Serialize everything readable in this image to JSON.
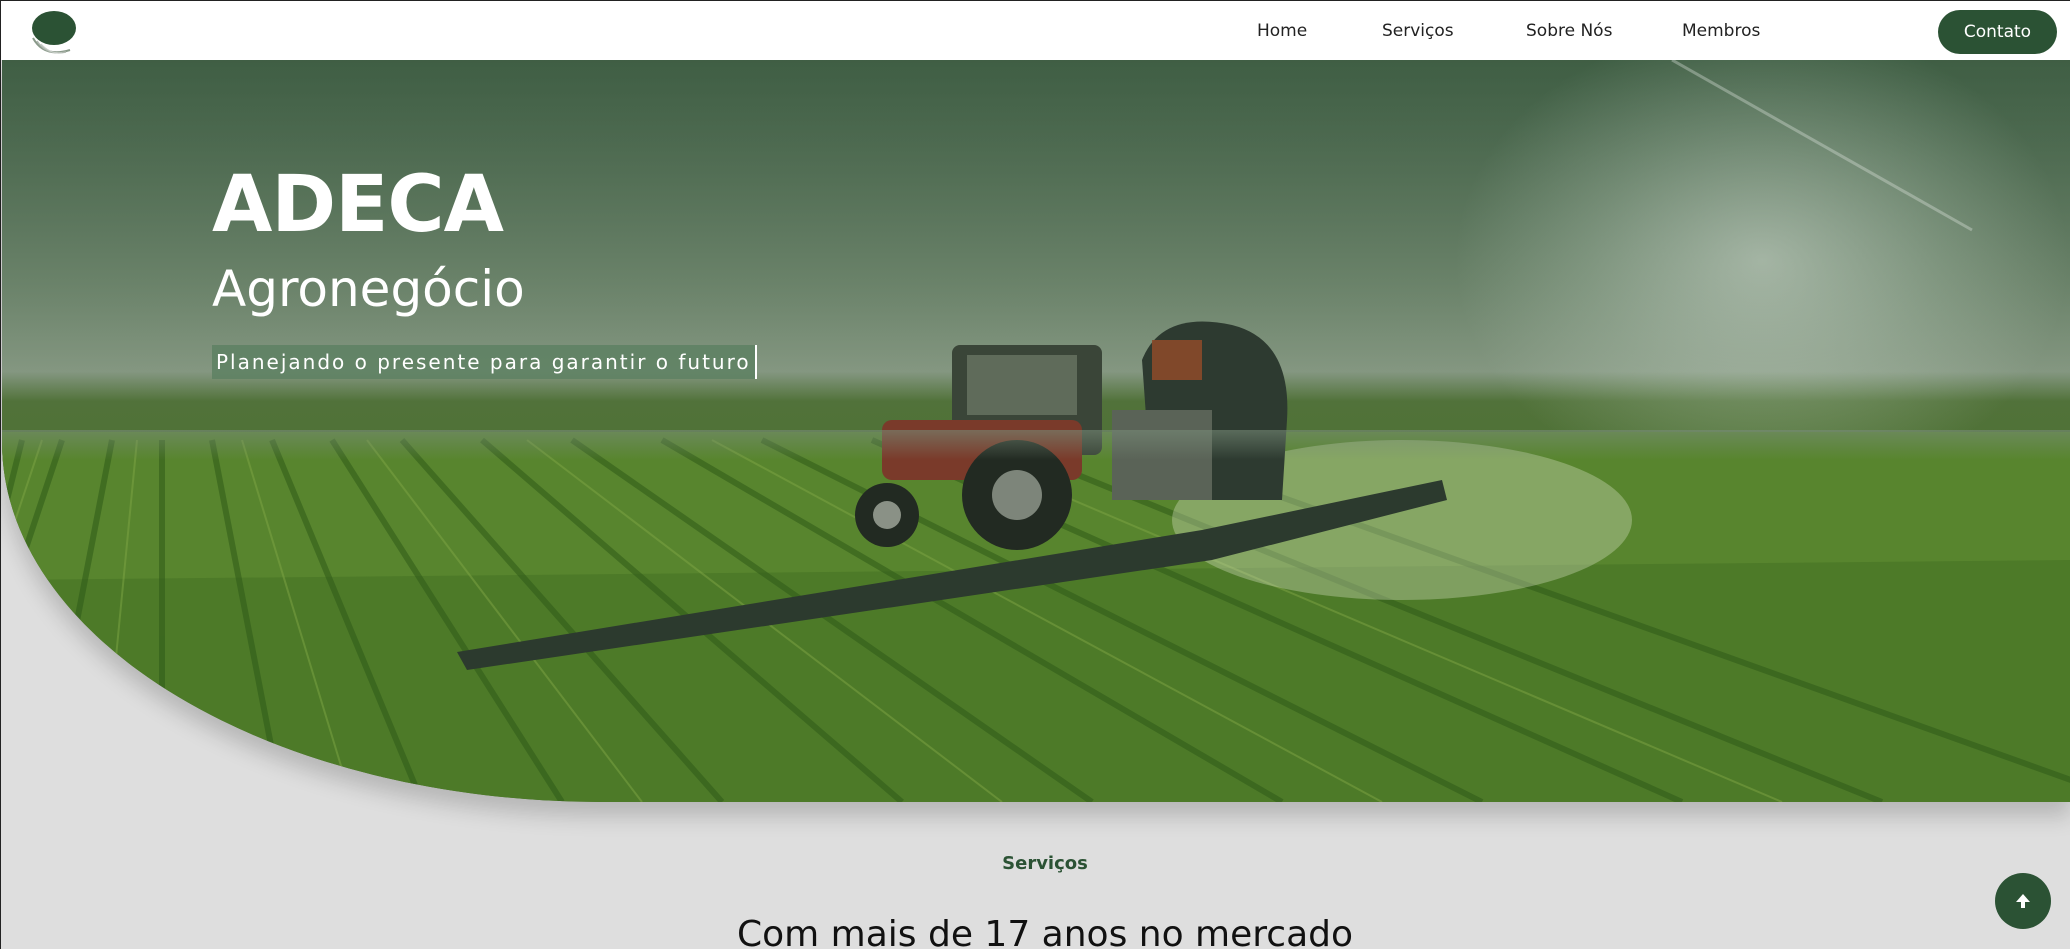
{
  "brand": {
    "logo_icon": "leaf-logo-icon",
    "color": "#2b5234"
  },
  "nav": {
    "links": [
      "Home",
      "Serviços",
      "Sobre Nós",
      "Membros"
    ],
    "contact_label": "Contato"
  },
  "hero": {
    "title": "ADECA",
    "subtitle": "Agronegócio",
    "tagline": "Planejando o presente para garantir o futuro",
    "image": "tractor-spraying-field-image"
  },
  "services": {
    "label": "Serviços",
    "heading": "Com mais de 17 anos no mercado"
  },
  "scroll_top": {
    "icon": "arrow-up-icon"
  },
  "colors": {
    "accent": "#2b5234",
    "page_bg": "#dedede",
    "nav_bg": "#ffffff"
  }
}
